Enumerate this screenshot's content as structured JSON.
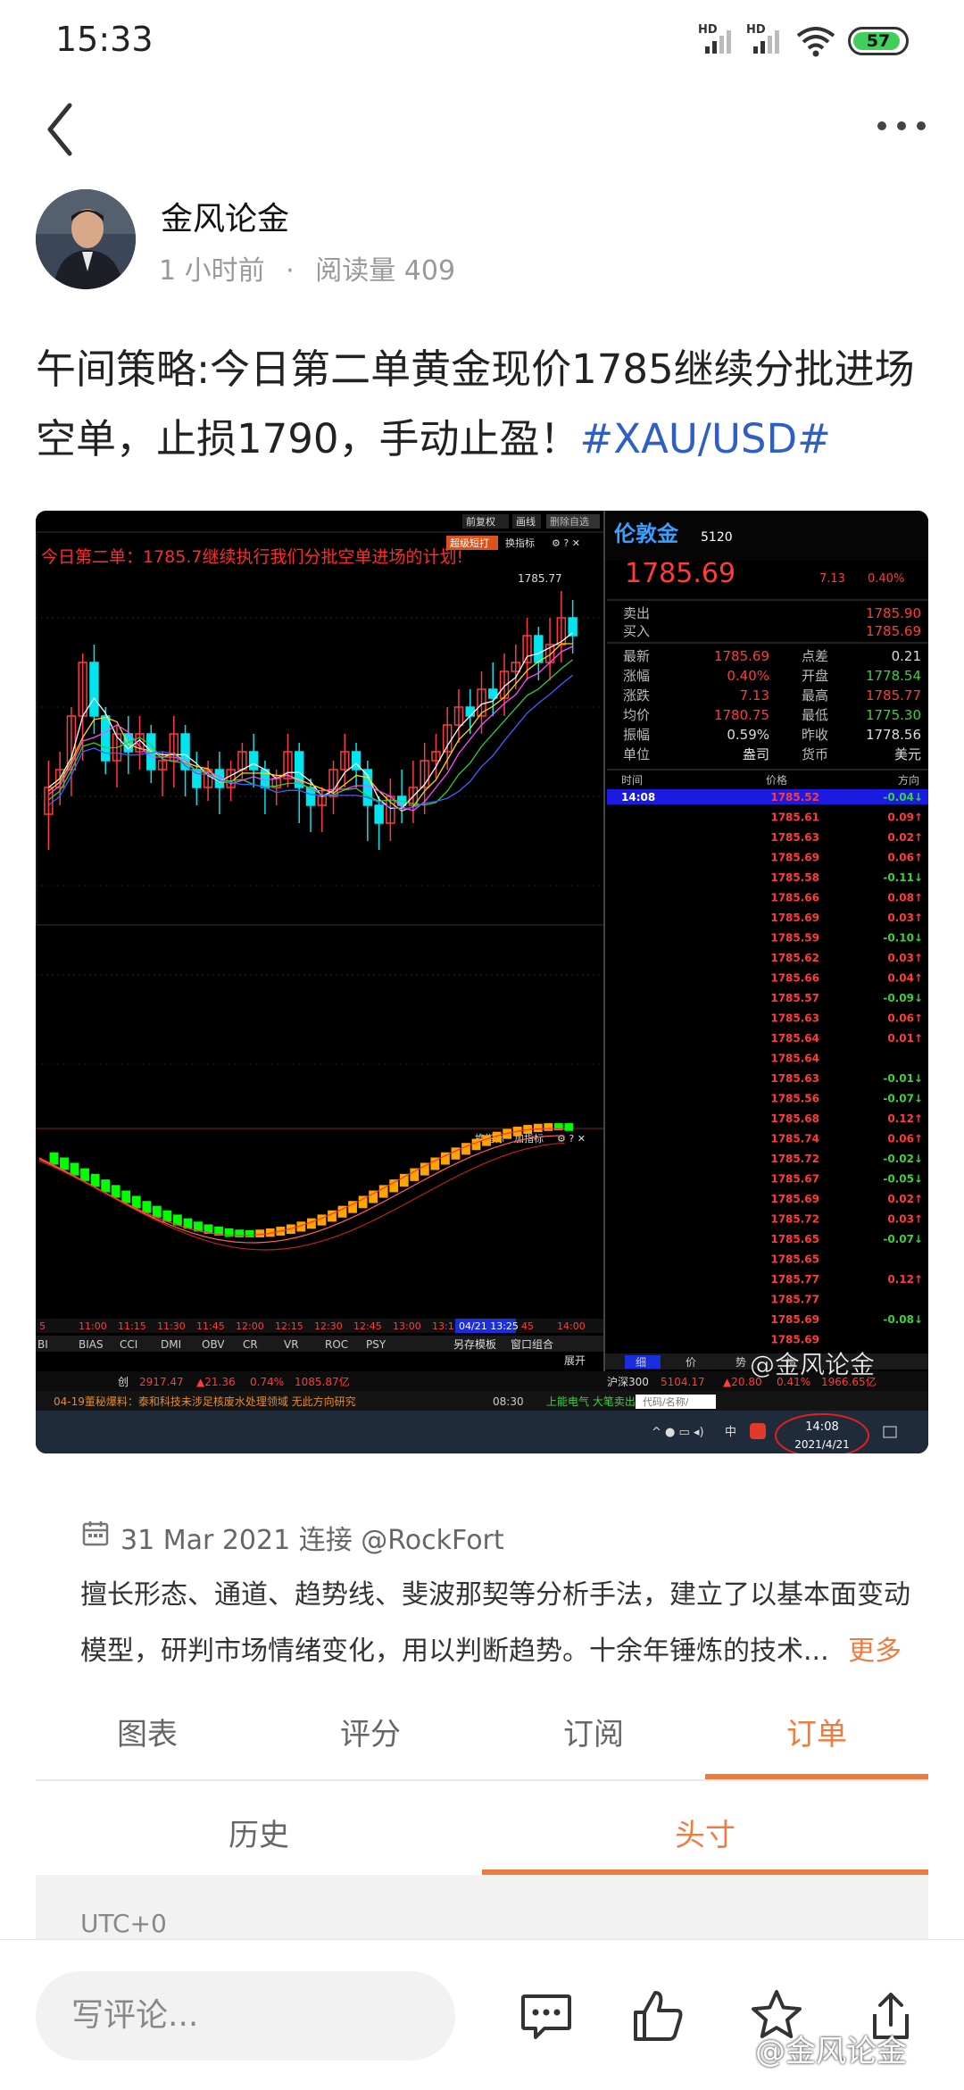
{
  "status_bar": {
    "time": "15:33",
    "signal1": "HD",
    "signal2": "HD",
    "battery": "57"
  },
  "author": {
    "name": "金风论金",
    "time_ago": "1 小时前",
    "separator": "·",
    "reads": "阅读量 409"
  },
  "post": {
    "title": "午间策略:今日第二单黄金现价1785继续分批进场空单，止损1790，手动止盈！",
    "hashtag": "#XAU/USD#"
  },
  "screenshot": {
    "toolbar_top": [
      "前复权",
      "画线",
      "删除自选"
    ],
    "toolbar_second": [
      "超级短打",
      "换指标"
    ],
    "annotation": "今日第二单：1785.7继续执行我们分批空单进场的计划!",
    "high_label": "1785.77",
    "indicator_toolbar": [
      "换指标",
      "加指标"
    ],
    "indicator_tabs": [
      "BI",
      "BIAS",
      "CCI",
      "DMI",
      "OBV",
      "CR",
      "VR",
      "ROC",
      "PSY"
    ],
    "time_axis": [
      "5",
      "11:00",
      "11:15",
      "11:30",
      "11:45",
      "12:00",
      "12:15",
      "12:30",
      "12:45",
      "13:00",
      "13:1"
    ],
    "time_axis_highlight": "04/21 13:25",
    "time_axis_end": [
      "45",
      "14:00"
    ],
    "extra_buttons": [
      "另存模板",
      "窗口组合",
      "展开"
    ],
    "quote": {
      "name": "伦敦金",
      "code": "5120",
      "price": "1785.69",
      "change": "7.13",
      "change_pct": "0.40%",
      "sell_label": "卖出",
      "sell": "1785.90",
      "buy_label": "买入",
      "buy": "1785.69",
      "stats": [
        [
          "最新",
          "1785.69",
          "点差",
          "0.21"
        ],
        [
          "涨幅",
          "0.40%",
          "开盘",
          "1778.54"
        ],
        [
          "涨跌",
          "7.13",
          "最高",
          "1785.77"
        ],
        [
          "均价",
          "1780.75",
          "最低",
          "1775.30"
        ],
        [
          "振幅",
          "0.59%",
          "昨收",
          "1778.56"
        ],
        [
          "单位",
          "盎司",
          "货币",
          "美元"
        ]
      ],
      "tick_headers": [
        "时间",
        "价格",
        "方向"
      ],
      "ticks": [
        [
          "14:08",
          "1785.52",
          "-0.04↓"
        ],
        [
          "",
          "1785.61",
          "0.09↑"
        ],
        [
          "",
          "1785.63",
          "0.02↑"
        ],
        [
          "",
          "1785.69",
          "0.06↑"
        ],
        [
          "",
          "1785.58",
          "-0.11↓"
        ],
        [
          "",
          "1785.66",
          "0.08↑"
        ],
        [
          "",
          "1785.69",
          "0.03↑"
        ],
        [
          "",
          "1785.59",
          "-0.10↓"
        ],
        [
          "",
          "1785.62",
          "0.03↑"
        ],
        [
          "",
          "1785.66",
          "0.04↑"
        ],
        [
          "",
          "1785.57",
          "-0.09↓"
        ],
        [
          "",
          "1785.63",
          "0.06↑"
        ],
        [
          "",
          "1785.64",
          "0.01↑"
        ],
        [
          "",
          "1785.64",
          ""
        ],
        [
          "",
          "1785.63",
          "-0.01↓"
        ],
        [
          "",
          "1785.56",
          "-0.07↓"
        ],
        [
          "",
          "1785.68",
          "0.12↑"
        ],
        [
          "",
          "1785.74",
          "0.06↑"
        ],
        [
          "",
          "1785.72",
          "-0.02↓"
        ],
        [
          "",
          "1785.67",
          "-0.05↓"
        ],
        [
          "",
          "1785.69",
          "0.02↑"
        ],
        [
          "",
          "1785.72",
          "0.03↑"
        ],
        [
          "",
          "1785.65",
          "-0.07↓"
        ],
        [
          "",
          "1785.65",
          ""
        ],
        [
          "",
          "1785.77",
          "0.12↑"
        ],
        [
          "",
          "1785.77",
          ""
        ],
        [
          "",
          "1785.69",
          "-0.08↓"
        ],
        [
          "",
          "1785.69",
          ""
        ]
      ],
      "bottom_tabs": [
        "细",
        "价",
        "势",
        "指"
      ]
    },
    "ticker_index": "创",
    "ticker_values": [
      "2917.47",
      "▲21.36",
      "0.74%",
      "1085.87亿"
    ],
    "ticker_index2": "沪深300",
    "ticker_values2": [
      "5104.17",
      "▲20.80",
      "0.41%",
      "1966.65亿"
    ],
    "news": "04-19董秘爆料：泰和科技未涉足核废水处理领域 无此方向研究",
    "news_time": "08:30",
    "news2": "上能电气 大笔卖出",
    "search_placeholder": "代码/名称/",
    "taskbar_time": "14:08",
    "taskbar_date": "2021/4/21",
    "taskbar_ime": "中",
    "watermark": "@金风论金"
  },
  "bio": {
    "date": "31 Mar 2021",
    "connect": "连接",
    "handle": "@RockFort",
    "text": "擅长形态、通道、趋势线、斐波那契等分析手法，建立了以基本面变动模型，研判市场情绪变化，用以判断趋势。十余年锤炼的技术...",
    "more": "更多"
  },
  "tabs": [
    "图表",
    "评分",
    "订阅",
    "订单"
  ],
  "subtabs": [
    "历史",
    "头寸"
  ],
  "utc": "UTC+0",
  "bottom": {
    "comment_placeholder": "写评论...",
    "watermark": "@金风论金"
  },
  "colors": {
    "accent": "#f07b3f",
    "hashtag": "#2f5fc6",
    "up": "#ff3b3b",
    "down": "#00e5ee"
  }
}
